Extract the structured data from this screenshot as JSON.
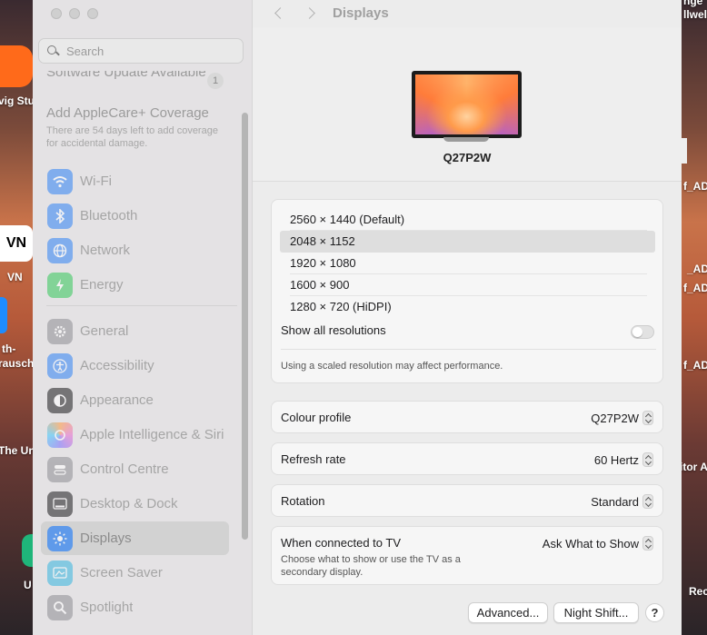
{
  "desktop": {
    "left_labels": [
      "vig Stu",
      "VN",
      "th-",
      "rausch",
      "The Un",
      "U"
    ],
    "right_labels": [
      "nge",
      "llwel",
      "f_AD",
      "_AD",
      "f_AD",
      "f_AD",
      "itor A",
      "Rec"
    ],
    "vn_icon_text": "VN"
  },
  "sidebar": {
    "search_placeholder": "Search",
    "software_update": "Software Update Available",
    "software_update_count": "1",
    "applecare_title": "Add AppleCare+ Coverage",
    "applecare_sub": "There are 54 days left to add coverage for accidental damage.",
    "items": [
      {
        "label": "Wi-Fi",
        "icon": "wifi-icon",
        "color": "#2f83f5"
      },
      {
        "label": "Bluetooth",
        "icon": "bluetooth-icon",
        "color": "#2f83f5"
      },
      {
        "label": "Network",
        "icon": "globe-icon",
        "color": "#2f83f5"
      },
      {
        "label": "Energy",
        "icon": "energy-icon",
        "color": "#33c759"
      },
      {
        "label": "General",
        "icon": "gear-icon",
        "color": "#8e8e93"
      },
      {
        "label": "Accessibility",
        "icon": "accessibility-icon",
        "color": "#2f83f5"
      },
      {
        "label": "Appearance",
        "icon": "appearance-icon",
        "color": "#1c1c1e"
      },
      {
        "label": "Apple Intelligence & Siri",
        "icon": "apple-intelligence-icon",
        "color": "#e86ad0"
      },
      {
        "label": "Control Centre",
        "icon": "control-centre-icon",
        "color": "#8e8e93"
      },
      {
        "label": "Desktop & Dock",
        "icon": "dock-icon",
        "color": "#1c1c1e"
      },
      {
        "label": "Displays",
        "icon": "sun-icon",
        "color": "#2f83f5"
      },
      {
        "label": "Screen Saver",
        "icon": "screen-saver-icon",
        "color": "#37b6e0"
      },
      {
        "label": "Spotlight",
        "icon": "spotlight-icon",
        "color": "#8e8e93"
      }
    ]
  },
  "main": {
    "title": "Displays",
    "display_name": "Q27P2W",
    "resolutions": [
      "2560 × 1440 (Default)",
      "2048 × 1152",
      "1920 × 1080",
      "1600 × 900",
      "1280 × 720 (HiDPI)"
    ],
    "selected_resolution": "2048 × 1152",
    "show_all_label": "Show all resolutions",
    "show_all_enabled": false,
    "scaled_note": "Using a scaled resolution may affect performance.",
    "colour_profile_label": "Colour profile",
    "colour_profile_value": "Q27P2W",
    "refresh_label": "Refresh rate",
    "refresh_value": "60 Hertz",
    "rotation_label": "Rotation",
    "rotation_value": "Standard",
    "tv_label": "When connected to TV",
    "tv_value": "Ask What to Show",
    "tv_sub": "Choose what to show or use the TV as a secondary display.",
    "advanced_button": "Advanced...",
    "night_shift_button": "Night Shift...",
    "help_button": "?"
  }
}
